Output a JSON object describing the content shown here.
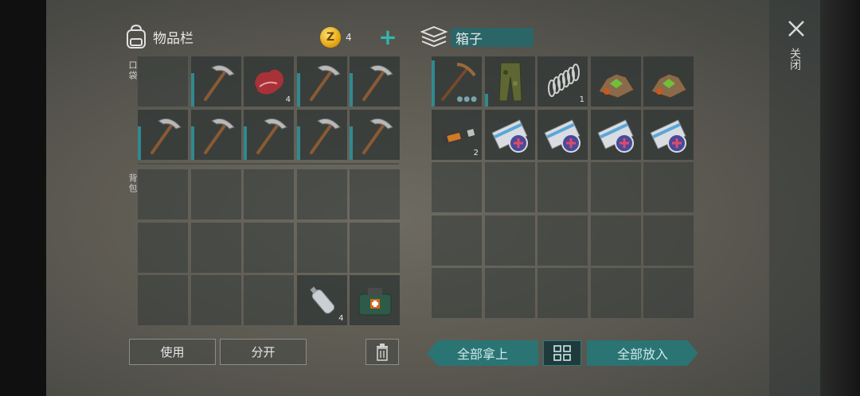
{
  "inventory": {
    "title": "物品栏",
    "coins": "4",
    "plus": "+",
    "pocket_label": "口袋",
    "backpack_label": "背包",
    "pocket_slots": [
      {
        "item": "",
        "qty": ""
      },
      {
        "item": "pickaxe",
        "qty": ""
      },
      {
        "item": "raw-meat",
        "qty": "4"
      },
      {
        "item": "pickaxe",
        "qty": ""
      },
      {
        "item": "pickaxe",
        "qty": ""
      },
      {
        "item": "pickaxe",
        "qty": ""
      },
      {
        "item": "pickaxe",
        "qty": ""
      },
      {
        "item": "pickaxe",
        "qty": ""
      },
      {
        "item": "pickaxe",
        "qty": ""
      },
      {
        "item": "pickaxe",
        "qty": ""
      }
    ],
    "backpack_slots": [
      {
        "item": "",
        "qty": ""
      },
      {
        "item": "",
        "qty": ""
      },
      {
        "item": "",
        "qty": ""
      },
      {
        "item": "",
        "qty": ""
      },
      {
        "item": "",
        "qty": ""
      },
      {
        "item": "",
        "qty": ""
      },
      {
        "item": "",
        "qty": ""
      },
      {
        "item": "",
        "qty": ""
      },
      {
        "item": "",
        "qty": ""
      },
      {
        "item": "",
        "qty": ""
      },
      {
        "item": "",
        "qty": ""
      },
      {
        "item": "",
        "qty": ""
      },
      {
        "item": "",
        "qty": ""
      },
      {
        "item": "water-bottle",
        "qty": "4"
      },
      {
        "item": "first-aid-kit",
        "qty": ""
      }
    ],
    "use_label": "使用",
    "split_label": "分开"
  },
  "box": {
    "title": "箱子",
    "slots": [
      {
        "item": "wooden-pickaxe",
        "qty": ""
      },
      {
        "item": "camo-pants",
        "qty": ""
      },
      {
        "item": "spring",
        "qty": "1"
      },
      {
        "item": "ore-pile",
        "qty": ""
      },
      {
        "item": "ore-pile",
        "qty": ""
      },
      {
        "item": "usb-drive",
        "qty": "2"
      },
      {
        "item": "blueprint-scroll",
        "qty": ""
      },
      {
        "item": "blueprint-scroll",
        "qty": ""
      },
      {
        "item": "blueprint-scroll",
        "qty": ""
      },
      {
        "item": "blueprint-scroll",
        "qty": ""
      }
    ],
    "take_all_label": "全部拿上",
    "put_all_label": "全部放入"
  },
  "close_label": "关闭",
  "colors": {
    "accent": "#2a7474",
    "durability": "#2f8a90",
    "coin": "#e7a711"
  }
}
